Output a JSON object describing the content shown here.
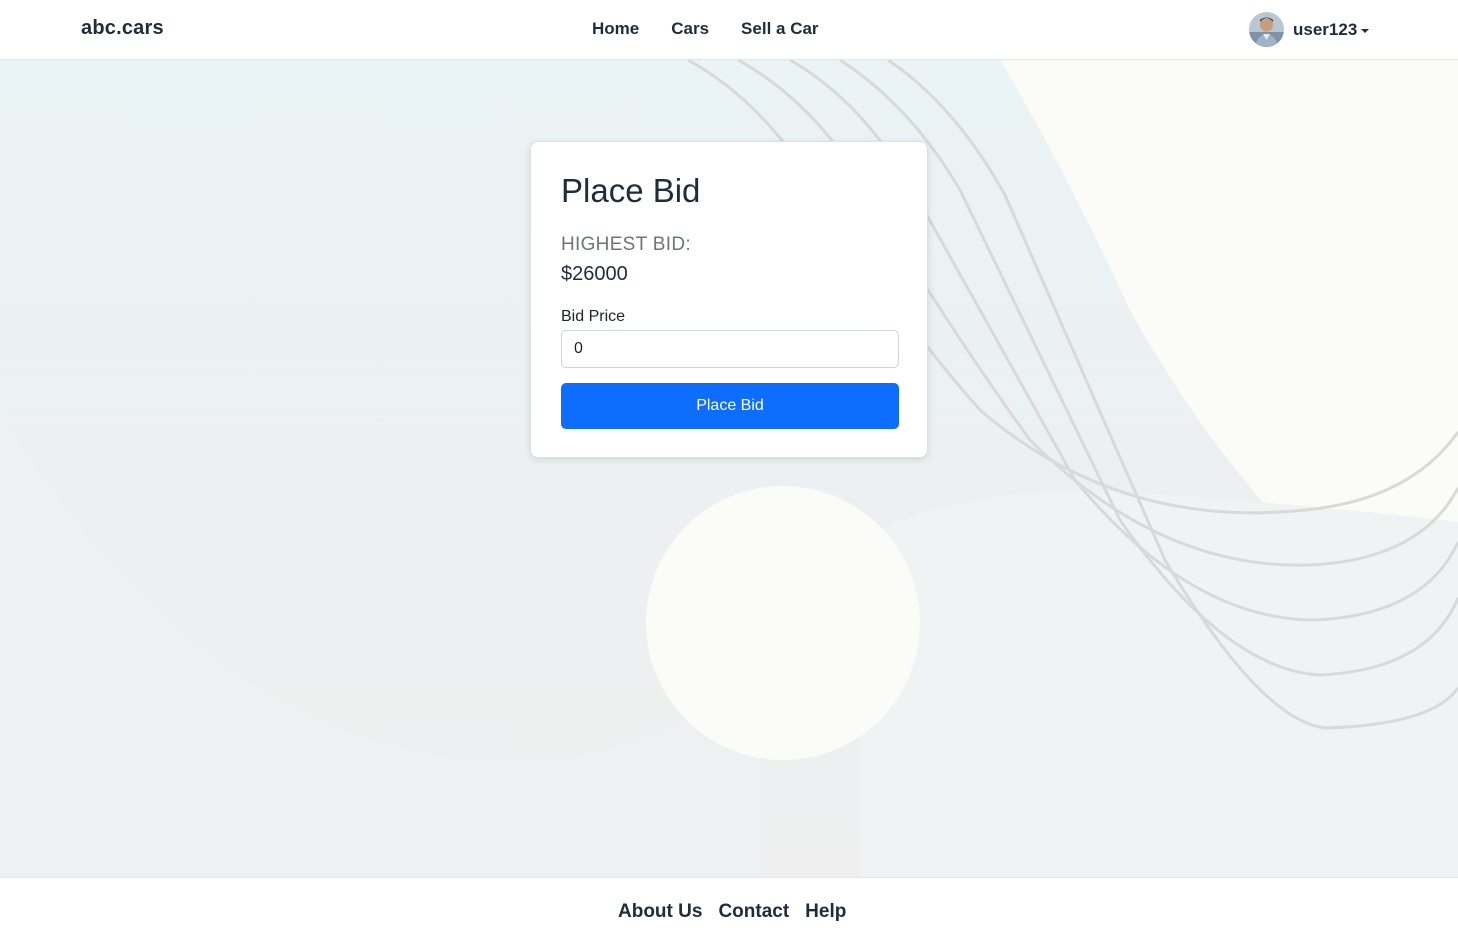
{
  "brand": "abc.cars",
  "nav": {
    "items": [
      {
        "label": "Home"
      },
      {
        "label": "Cars"
      },
      {
        "label": "Sell a Car"
      }
    ]
  },
  "user": {
    "name": "user123",
    "avatar_icon": "user-avatar-icon"
  },
  "bid_card": {
    "title": "Place Bid",
    "highest_bid_label": "HIGHEST BID:",
    "highest_bid_value": "$26000",
    "field_label": "Bid Price",
    "field_value": "0",
    "button_label": "Place Bid"
  },
  "footer": {
    "links": [
      {
        "label": "About Us"
      },
      {
        "label": "Contact"
      },
      {
        "label": "Help"
      }
    ]
  },
  "colors": {
    "primary_button": "#0d6efd",
    "text_dark": "#1f2d3a",
    "muted": "#6c757d"
  }
}
